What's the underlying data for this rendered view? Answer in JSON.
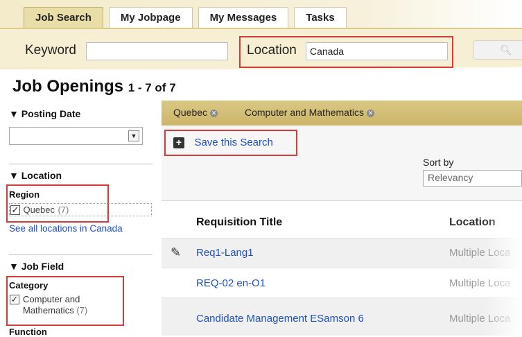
{
  "tabs": [
    {
      "label": "Job Search",
      "active": true
    },
    {
      "label": "My Jobpage",
      "active": false
    },
    {
      "label": "My Messages",
      "active": false
    },
    {
      "label": "Tasks",
      "active": false
    }
  ],
  "search": {
    "keyword_label": "Keyword",
    "keyword_value": "",
    "location_label": "Location",
    "location_value": "Canada",
    "search_icon": "search-icon"
  },
  "results": {
    "heading": "Job Openings",
    "count": "1 - 7 of 7"
  },
  "sidebar": {
    "posting_date": {
      "title": "▼ Posting Date",
      "selected": ""
    },
    "location": {
      "title": "▼ Location",
      "region_label": "Region",
      "option_label": "Quebec",
      "option_count": "(7)",
      "checked": true,
      "see_all": "See all locations in Canada"
    },
    "job_field": {
      "title": "▼ Job Field",
      "category_label": "Category",
      "option_label_1": "Computer and",
      "option_label_2": "Mathematics",
      "option_count": "(7)",
      "checked": true,
      "function_label": "Function"
    }
  },
  "filters": {
    "chips": [
      "Quebec",
      "Computer and Mathematics"
    ]
  },
  "save_search": {
    "label": "Save this Search"
  },
  "sort": {
    "label": "Sort by",
    "selected": "Relevancy"
  },
  "table": {
    "col_title": "Requisition Title",
    "col_location": "Location",
    "rows": [
      {
        "title": "Req1-Lang1",
        "location": "Multiple Loca",
        "edit_icon": "pencil-icon"
      },
      {
        "title": "REQ-02 en-O1",
        "location": "Multiple Loca"
      },
      {
        "title": "Candidate Management ESamson 6",
        "location": "Multiple Loca"
      }
    ]
  },
  "colors": {
    "accent_band": "#f3ebc9",
    "filter_bar": "#cdb56a",
    "link": "#1f4fc1",
    "highlight_box": "#d43c3c"
  }
}
